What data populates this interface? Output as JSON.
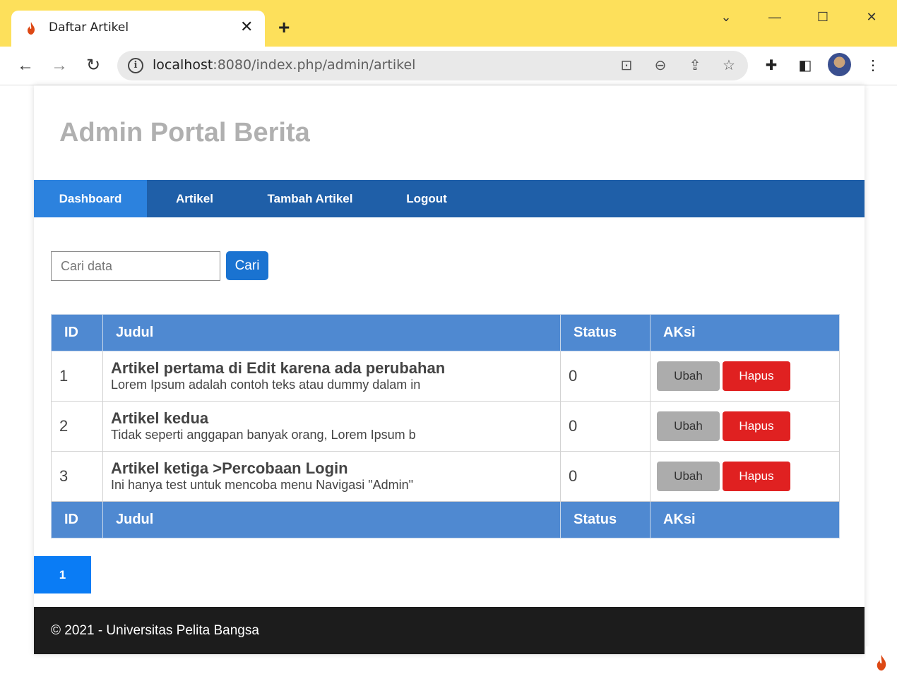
{
  "browser": {
    "tab_title": "Daftar Artikel",
    "url_host": "localhost",
    "url_path": ":8080/index.php/admin/artikel"
  },
  "header": {
    "site_title": "Admin Portal Berita"
  },
  "nav": {
    "items": [
      {
        "label": "Dashboard"
      },
      {
        "label": "Artikel"
      },
      {
        "label": "Tambah Artikel"
      },
      {
        "label": "Logout"
      }
    ]
  },
  "search": {
    "placeholder": "Cari data",
    "button_label": "Cari"
  },
  "table": {
    "headers": [
      "ID",
      "Judul",
      "Status",
      "AKsi"
    ],
    "rows": [
      {
        "id": "1",
        "title": "Artikel pertama di Edit karena ada perubahan",
        "desc": "Lorem Ipsum adalah contoh teks atau dummy dalam in",
        "status": "0",
        "edit": "Ubah",
        "delete": "Hapus"
      },
      {
        "id": "2",
        "title": "Artikel kedua",
        "desc": "Tidak seperti anggapan banyak orang, Lorem Ipsum b",
        "status": "0",
        "edit": "Ubah",
        "delete": "Hapus"
      },
      {
        "id": "3",
        "title": "Artikel ketiga >Percobaan Login",
        "desc": "Ini hanya test untuk mencoba menu Navigasi \"Admin\"",
        "status": "0",
        "edit": "Ubah",
        "delete": "Hapus"
      }
    ]
  },
  "pagination": {
    "current_page": "1"
  },
  "footer": {
    "text": "© 2021 - Universitas Pelita Bangsa"
  },
  "colors": {
    "tabbar": "#fde05b",
    "navbar": "#1f5fa8",
    "nav_active": "#2c82de",
    "table_header": "#4f89d1",
    "delete_button": "#e02121",
    "footer": "#1c1c1c"
  }
}
